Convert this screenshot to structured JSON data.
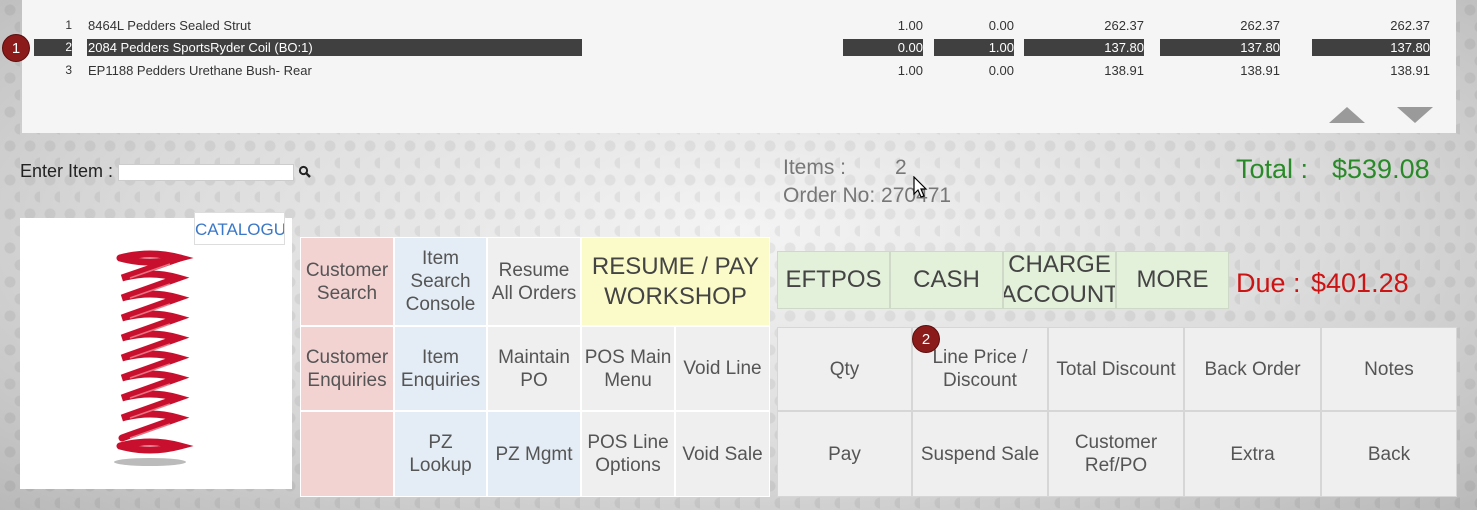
{
  "lines": [
    {
      "num": "1",
      "desc": "8464L Pedders Sealed Strut",
      "qty": "1.00",
      "bo": "0.00",
      "price": "262.37",
      "total": "262.37",
      "gross": "262.37"
    },
    {
      "num": "2",
      "desc": "2084 Pedders SportsRyder Coil (BO:1)",
      "qty": "0.00",
      "bo": "1.00",
      "price": "137.80",
      "total": "137.80",
      "gross": "137.80"
    },
    {
      "num": "3",
      "desc": "EP1188 Pedders Urethane Bush- Rear",
      "qty": "1.00",
      "bo": "0.00",
      "price": "138.91",
      "total": "138.91",
      "gross": "138.91"
    }
  ],
  "badges": {
    "one": "1",
    "two": "2"
  },
  "entry": {
    "label": "Enter Item :",
    "value": ""
  },
  "summary": {
    "items_label": "Items :",
    "items_value": "2",
    "order_label": "Order No: 270471",
    "total_label": "Total :",
    "total_value": "$539.08",
    "due_label": "Due :",
    "due_value": "$401.28"
  },
  "catalogue_label": "CATALOGU",
  "grid": {
    "customer_search": "Customer Search",
    "item_search_console": "Item Search Console",
    "resume_all_orders": "Resume All Orders",
    "resume_pay_workshop": "RESUME / PAY WORKSHOP",
    "customer_enquiries": "Customer Enquiries",
    "item_enquiries": "Item Enquiries",
    "maintain_po": "Maintain PO",
    "pos_main_menu": "POS Main Menu",
    "void_line": "Void Line",
    "pz_lookup": "PZ Lookup",
    "pz_mgmt": "PZ Mgmt",
    "pos_line_options": "POS Line Options",
    "void_sale": "Void Sale"
  },
  "payment": {
    "eftpos": "EFTPOS",
    "cash": "CASH",
    "charge_account": "CHARGE ACCOUNT",
    "more": "MORE"
  },
  "actions": {
    "qty": "Qty",
    "line_price_discount": "Line Price / Discount",
    "total_discount": "Total Discount",
    "back_order": "Back Order",
    "notes": "Notes",
    "pay": "Pay",
    "suspend_sale": "Suspend Sale",
    "customer_ref_po": "Customer Ref/PO",
    "extra": "Extra",
    "back": "Back"
  },
  "colors": {
    "total": "#2a8a2a",
    "due": "#cc1414",
    "badge": "#8b1a1a"
  }
}
